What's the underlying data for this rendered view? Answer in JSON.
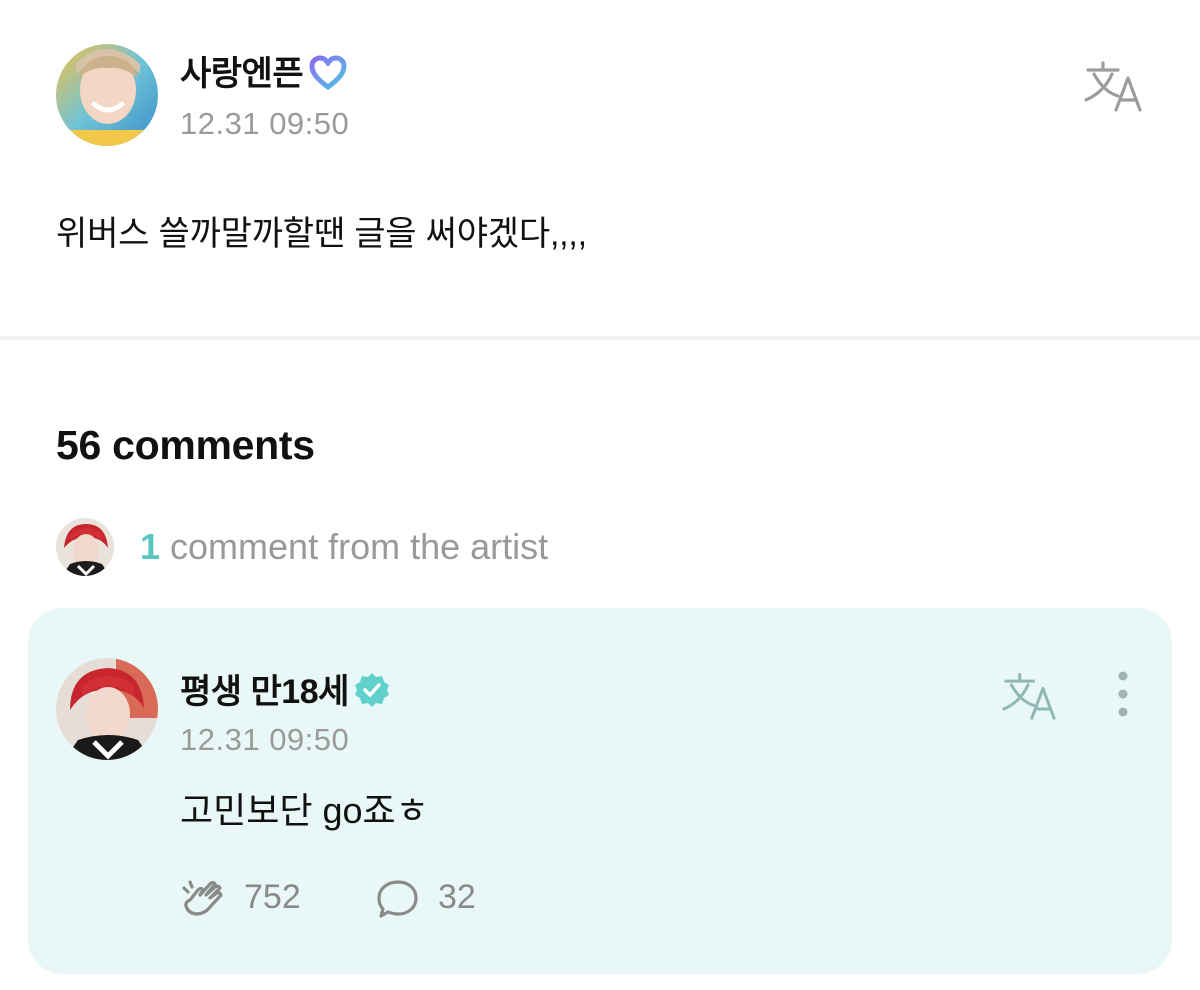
{
  "post": {
    "author": "사랑엔픈",
    "time": "12.31 09:50",
    "body": "위버스 쓸까말까할땐 글을 써야겠다,,,,"
  },
  "comments": {
    "count_label": "56 comments",
    "artist_count": "1",
    "artist_label": " comment from the artist",
    "items": [
      {
        "author": "평생 만18세",
        "time": "12.31 09:50",
        "body": "고민보단 go죠ㅎ",
        "likes": "752",
        "replies": "32"
      }
    ]
  },
  "icons": {
    "fan_badge": "heart-badge-icon",
    "artist_badge": "verified-badge-icon",
    "translate": "translate-icon",
    "more": "more-vertical-icon",
    "like": "clap-icon",
    "reply": "speech-bubble-icon"
  },
  "colors": {
    "accent": "#58c7c4",
    "card_bg": "#e9f8f6",
    "muted_text": "#9a9a9a"
  }
}
